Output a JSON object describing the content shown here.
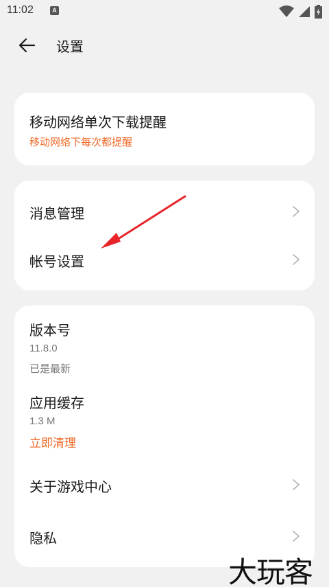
{
  "status_bar": {
    "time": "11:02",
    "notification_badge": "A",
    "icons": [
      "wifi-icon",
      "signal-icon",
      "battery-charging-icon"
    ]
  },
  "header": {
    "back_icon": "arrow-left-icon",
    "title": "设置"
  },
  "card_download": {
    "title": "移动网络单次下载提醒",
    "subtitle": "移动网络下每次都提醒"
  },
  "card_manage": {
    "message_title": "消息管理",
    "account_title": "帐号设置"
  },
  "card_info": {
    "version_title": "版本号",
    "version_value": "11.8.0",
    "version_status": "已是最新",
    "cache_title": "应用缓存",
    "cache_size": "1.3 M",
    "cache_clear": "立即清理",
    "about_title": "关于游戏中心",
    "privacy_title": "隐私"
  },
  "annotation": {
    "arrow_color": "#e8232a"
  },
  "watermark": "大玩客",
  "colors": {
    "accent": "#f06a27",
    "background": "#f1f1f1",
    "card": "#ffffff"
  }
}
